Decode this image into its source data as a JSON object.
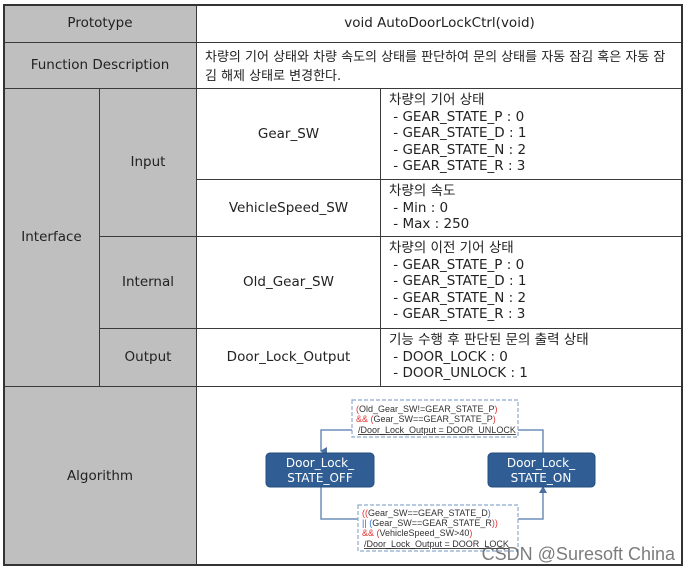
{
  "table": {
    "prototype": {
      "label": "Prototype",
      "value": "void AutoDoorLockCtrl(void)"
    },
    "function_description": {
      "label": "Function Description",
      "value": "차량의 기어 상태와 차량 속도의 상태를 판단하여 문의 상태를 자동 잠김 혹은 자동 잠김 해제 상태로 변경한다."
    },
    "interface": {
      "label": "Interface",
      "groups": {
        "input": {
          "label": "Input",
          "rows": [
            {
              "name": "Gear_SW",
              "desc_title": "차량의 기어 상태",
              "desc_items": [
                " - GEAR_STATE_P : 0",
                " - GEAR_STATE_D : 1",
                " - GEAR_STATE_N : 2",
                " - GEAR_STATE_R : 3"
              ]
            },
            {
              "name": "VehicleSpeed_SW",
              "desc_title": "차량의 속도",
              "desc_items": [
                " - Min : 0",
                " - Max : 250"
              ]
            }
          ]
        },
        "internal": {
          "label": "Internal",
          "rows": [
            {
              "name": "Old_Gear_SW",
              "desc_title": "차량의 이전 기어 상태",
              "desc_items": [
                " - GEAR_STATE_P : 0",
                " - GEAR_STATE_D : 1",
                " - GEAR_STATE_N : 2",
                " - GEAR_STATE_R : 3"
              ]
            }
          ]
        },
        "output": {
          "label": "Output",
          "rows": [
            {
              "name": "Door_Lock_Output",
              "desc_title": "기능 수행 후 판단된 문의 출력 상태",
              "desc_items": [
                " - DOOR_LOCK : 0",
                " - DOOR_UNLOCK : 1"
              ]
            }
          ]
        }
      }
    },
    "algorithm": {
      "label": "Algorithm",
      "states": {
        "off": [
          "Door_Lock_",
          "STATE_OFF"
        ],
        "on": [
          "Door_Lock_",
          "STATE_ON"
        ]
      },
      "transition_to_off": {
        "line1_open": "(",
        "line1_body": "Old_Gear_SW!=GEAR_STATE_P",
        "line1_close": ")",
        "line2_op": "&&",
        "line2_open": " (",
        "line2_body": "Gear_SW==GEAR_STATE_P",
        "line2_close": ")",
        "action": "/Door_Lock_Output = DOOR_UNLOCK"
      },
      "transition_to_on": {
        "line1_open": "((",
        "line1_body": "Gear_SW==GEAR_STATE_D",
        "line1_close": ")",
        "line2_op": "||",
        "line2_open": " (",
        "line2_body": "Gear_SW==GEAR_STATE_R",
        "line2_close": "))",
        "line3_op": "&&",
        "line3_open": " (",
        "line3_body": "VehicleSpeed_SW>40",
        "line3_close": ")",
        "action": "/Door_Lock_Output = DOOR_LOCK"
      }
    }
  },
  "watermark": "CSDN @Suresoft China",
  "colors": {
    "header_bg": "#bfbfbf",
    "state_fill": "#2f5d94",
    "connector": "#6f8fb8",
    "condition_border": "#8eaad0",
    "operator_red": "#e03030",
    "operator_blue": "#2f6fd0"
  }
}
